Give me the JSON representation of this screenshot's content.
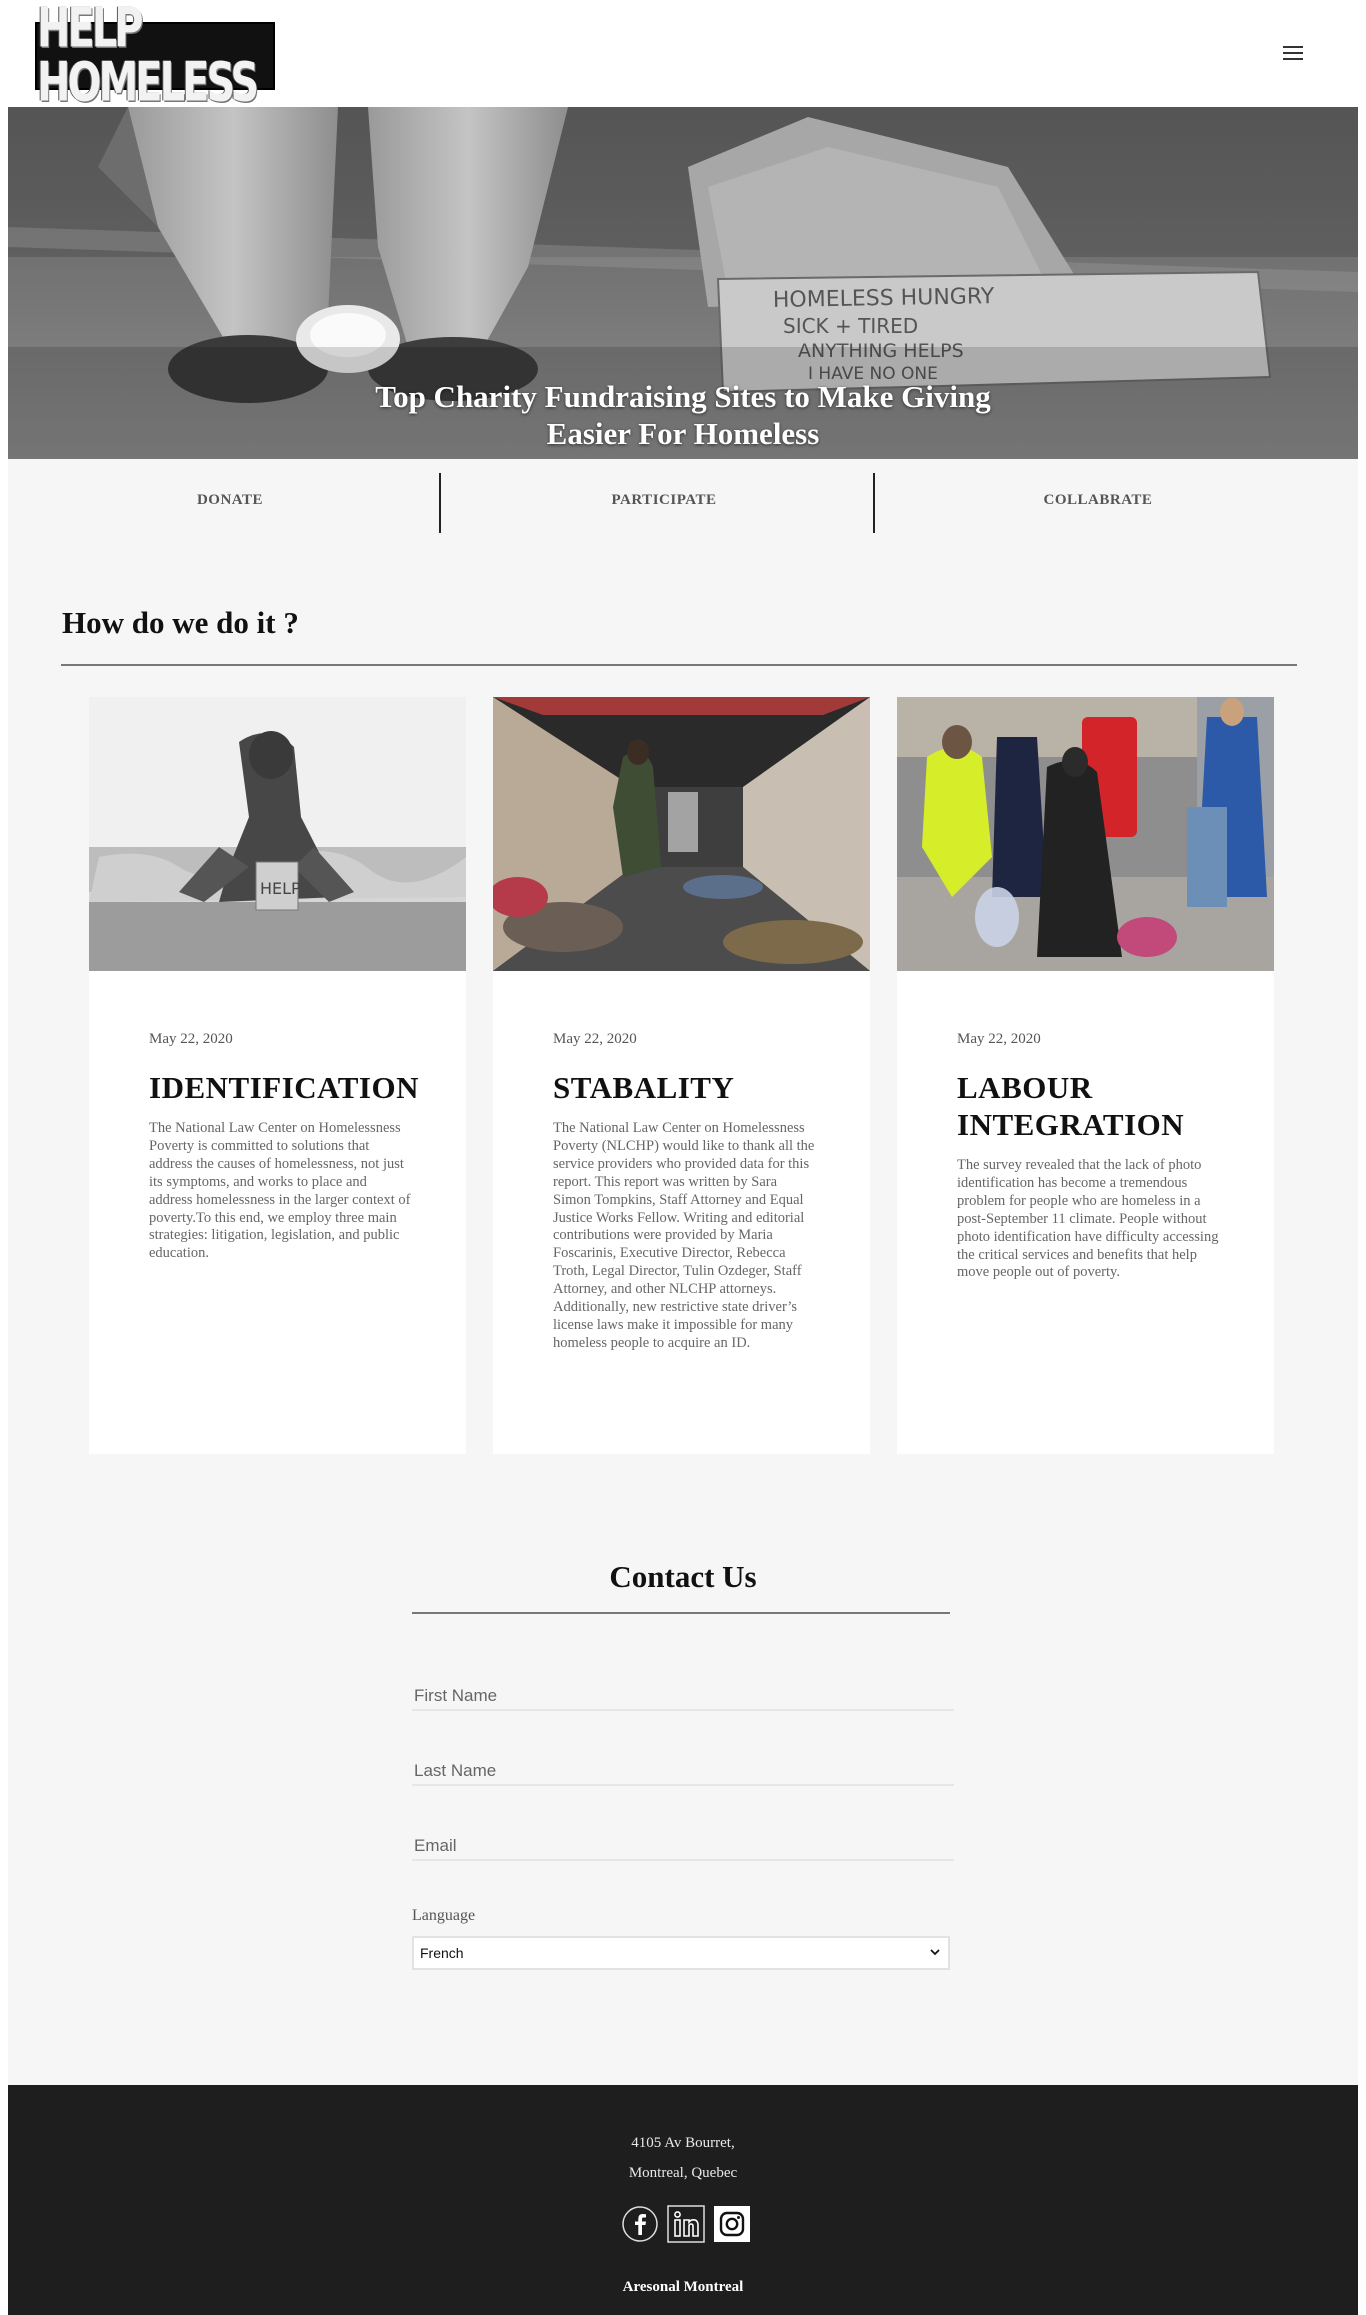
{
  "header": {
    "logo_text": "HELP HOMELESS",
    "menu_icon": "hamburger-menu-icon"
  },
  "hero": {
    "title": "Top Charity Fundraising Sites to Make Giving Easier For Homeless",
    "sign_text": "HOMELESS HUNGRY SICK + TIRED ANYTHING HELPS I HAVE NO ONE"
  },
  "actions": [
    "DONATE",
    "PARTICIPATE",
    "COLLABRATE"
  ],
  "how": {
    "title": "How do we do it ?",
    "cards": [
      {
        "date": "May 22, 2020",
        "title": "IDENTIFICATION",
        "image_text": "HELP",
        "body": "The National Law Center on Homelessness Poverty is committed to solutions that address the causes of homelessness, not just its symptoms, and works to place and address homelessness in the larger context of poverty.To this end, we employ three main strategies: litigation, legislation, and public education."
      },
      {
        "date": "May 22, 2020",
        "title": "STABALITY",
        "body": "The National Law Center on Homelessness Poverty (NLCHP) would like to thank all the service providers who provided data for this report. This report was written by Sara Simon Tompkins, Staff Attorney and Equal Justice Works Fellow. Writing and editorial contributions were provided by Maria Foscarinis, Executive Director, Rebecca Troth, Legal Director, Tulin Ozdeger, Staff Attorney, and other NLCHP attorneys. Additionally, new restrictive state driver’s license laws make it impossible for many homeless people to acquire an ID."
      },
      {
        "date": "May 22, 2020",
        "title": "LABOUR INTEGRATION",
        "body": "The survey revealed that the lack of photo identification has become a tremendous problem for people who are homeless in a post-September 11 climate. People without photo identification have difficulty accessing the critical services and benefits that help move people out of poverty."
      }
    ]
  },
  "contact": {
    "title": "Contact Us",
    "first_name_placeholder": "First Name",
    "last_name_placeholder": "Last Name",
    "email_placeholder": "Email",
    "language_label": "Language",
    "language_value": "French"
  },
  "footer": {
    "address_line1": "4105 Av Bourret,",
    "address_line2": "Montreal, Quebec",
    "socials": [
      "facebook-icon",
      "linkedin-icon",
      "instagram-icon"
    ],
    "brand": "Aresonal Montreal"
  }
}
